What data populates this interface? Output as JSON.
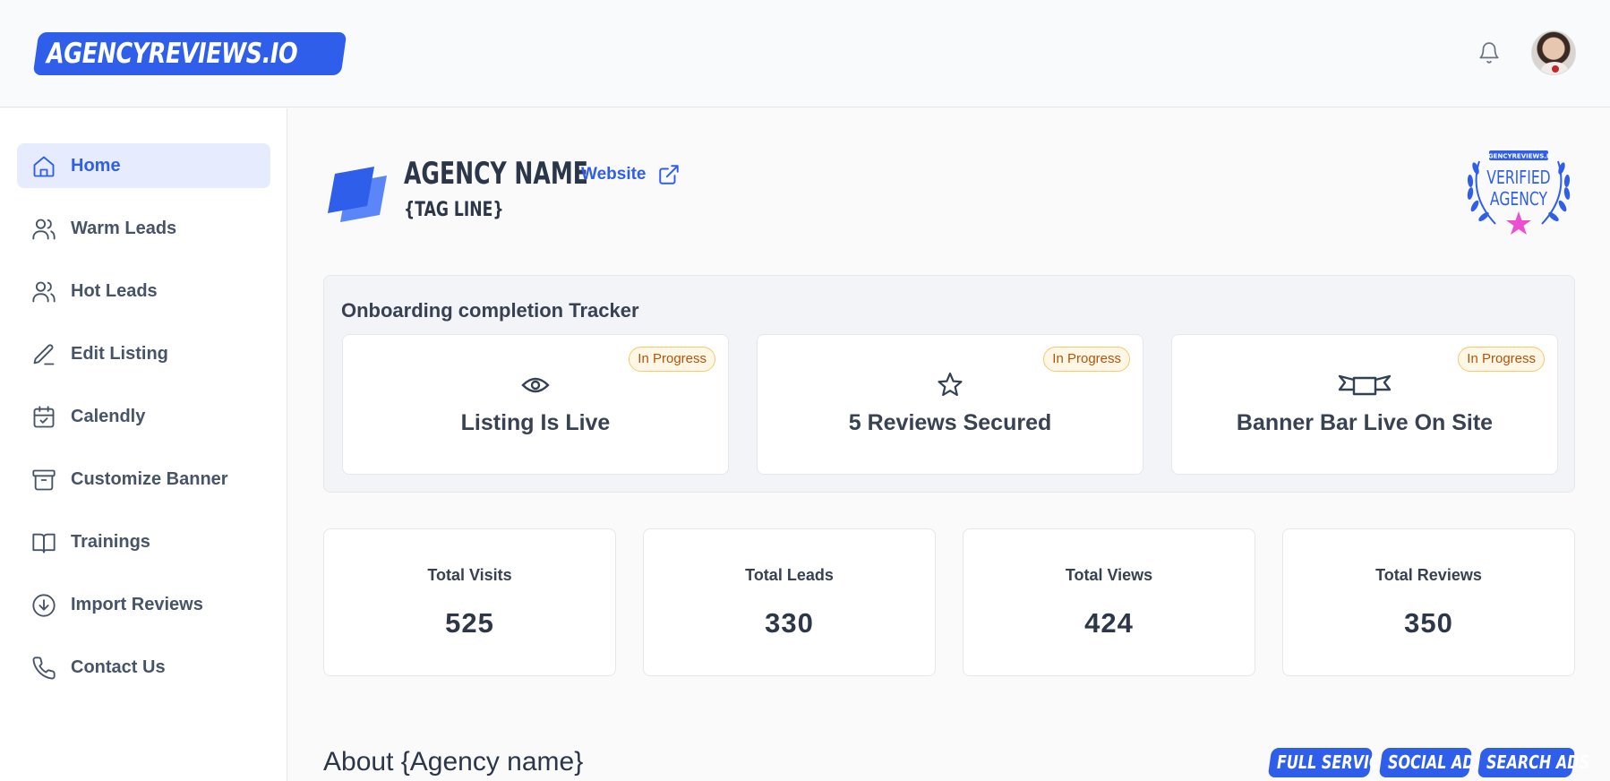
{
  "header": {
    "logo_text": "AGENCYREVIEWS.IO",
    "notification_icon": "bell-icon",
    "avatar_icon": "user-avatar"
  },
  "sidebar": {
    "items": [
      {
        "label": "Home",
        "icon": "home-icon",
        "active": true
      },
      {
        "label": "Warm Leads",
        "icon": "users-icon"
      },
      {
        "label": "Hot Leads",
        "icon": "users-icon"
      },
      {
        "label": "Edit Listing",
        "icon": "pencil-icon"
      },
      {
        "label": "Calendly",
        "icon": "calendar-check-icon"
      },
      {
        "label": "Customize Banner",
        "icon": "archive-icon"
      },
      {
        "label": "Trainings",
        "icon": "book-open-icon"
      },
      {
        "label": "Import Reviews",
        "icon": "download-circle-icon"
      },
      {
        "label": "Contact Us",
        "icon": "phone-icon"
      }
    ]
  },
  "agency": {
    "name": "AGENCY NAME",
    "tagline": "{TAG LINE}",
    "website_label": "Website",
    "badge": {
      "top": "AGENCYREVIEWS.IO",
      "line1": "VERIFIED",
      "line2": "AGENCY"
    }
  },
  "tracker": {
    "title": "Onboarding completion Tracker",
    "tasks": [
      {
        "label": "Listing Is Live",
        "status": "In Progress",
        "icon": "eye-icon"
      },
      {
        "label": "5 Reviews Secured",
        "status": "In Progress",
        "icon": "star-icon"
      },
      {
        "label": "Banner Bar Live On Site",
        "status": "In Progress",
        "icon": "banner-icon"
      }
    ]
  },
  "stats": [
    {
      "label": "Total Visits",
      "value": "525"
    },
    {
      "label": "Total Leads",
      "value": "330"
    },
    {
      "label": "Total Views",
      "value": "424"
    },
    {
      "label": "Total Reviews",
      "value": "350"
    }
  ],
  "about": {
    "title": "About {Agency name}",
    "tags": [
      "FULL SERVICE",
      "SOCIAL ADS",
      "SEARCH ADS"
    ]
  },
  "colors": {
    "accent": "#2f5eea",
    "active_bg": "#e6ecfd",
    "warning_text": "#b45309",
    "warning_bg": "#fff7e6",
    "badge_star": "#ec4fd0"
  }
}
